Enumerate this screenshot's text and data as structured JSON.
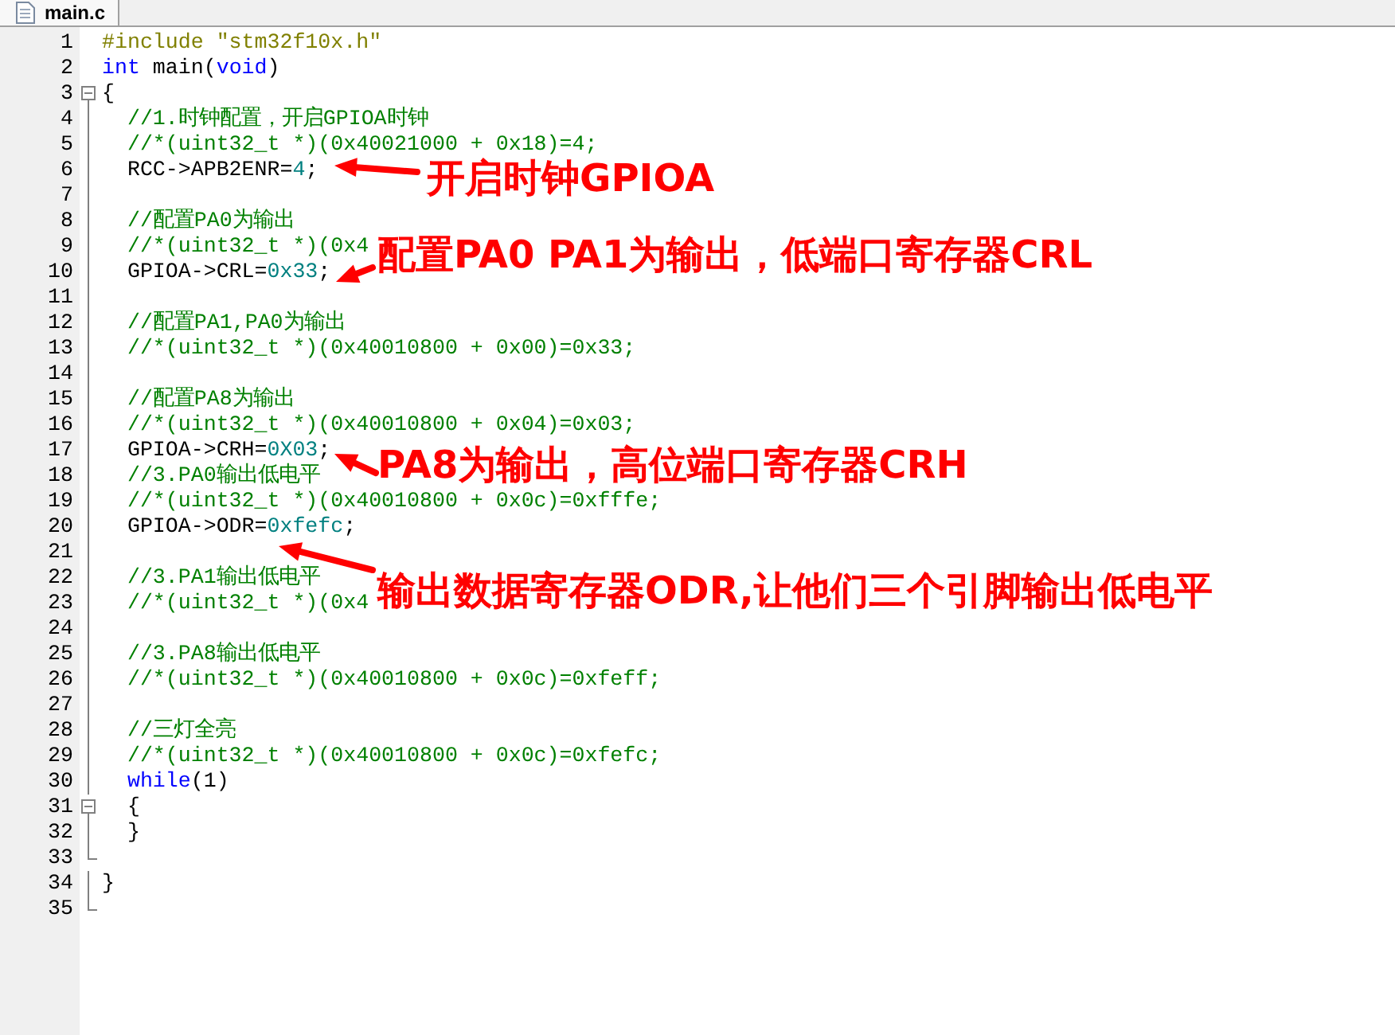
{
  "tab": {
    "label": "main.c",
    "selected": true
  },
  "lines": [
    {
      "number": "1",
      "kind": "plain",
      "segments": [
        {
          "text": "#include \"stm32f10x.h\"",
          "kind": "preprocessor"
        }
      ]
    },
    {
      "number": "2",
      "kind": "plain",
      "segments": [
        {
          "text": "int",
          "kind": "keyword"
        },
        {
          "text": " main(",
          "kind": "plain"
        },
        {
          "text": "void",
          "kind": "keyword"
        },
        {
          "text": ")",
          "kind": "plain"
        }
      ]
    },
    {
      "number": "3",
      "kind": "foldstart",
      "segments": [
        {
          "text": "{",
          "kind": "plain"
        }
      ]
    },
    {
      "number": "4",
      "kind": "folded",
      "segments": [
        {
          "text": "  //1.时钟配置，开启GPIOA时钟",
          "kind": "comment"
        }
      ]
    },
    {
      "number": "5",
      "kind": "folded",
      "segments": [
        {
          "text": "  //*(uint32_t *)(0x40021000 + 0x18)=4;",
          "kind": "comment"
        }
      ]
    },
    {
      "number": "6",
      "kind": "folded",
      "segments": [
        {
          "text": "  RCC->APB2ENR=",
          "kind": "plain"
        },
        {
          "text": "4",
          "kind": "number"
        },
        {
          "text": ";",
          "kind": "plain"
        }
      ]
    },
    {
      "number": "7",
      "kind": "folded"
    },
    {
      "number": "8",
      "kind": "folded",
      "segments": [
        {
          "text": "  //配置PA0为输出",
          "kind": "comment"
        }
      ]
    },
    {
      "number": "9",
      "kind": "folded",
      "segments": [
        {
          "text": "  //*(uint32_t *)(0x4",
          "kind": "comment"
        }
      ]
    },
    {
      "number": "10",
      "kind": "folded",
      "segments": [
        {
          "text": "  GPIOA->CRL=",
          "kind": "plain"
        },
        {
          "text": "0x33",
          "kind": "number"
        },
        {
          "text": ";",
          "kind": "plain"
        }
      ]
    },
    {
      "number": "11",
      "kind": "folded"
    },
    {
      "number": "12",
      "kind": "folded",
      "segments": [
        {
          "text": "  //配置PA1,PA0为输出",
          "kind": "comment"
        }
      ]
    },
    {
      "number": "13",
      "kind": "folded",
      "segments": [
        {
          "text": "  //*(uint32_t *)(0x40010800 + 0x00)=0x33;",
          "kind": "comment"
        }
      ]
    },
    {
      "number": "14",
      "kind": "folded"
    },
    {
      "number": "15",
      "kind": "folded",
      "segments": [
        {
          "text": "  //配置PA8为输出",
          "kind": "comment"
        }
      ]
    },
    {
      "number": "16",
      "kind": "folded",
      "segments": [
        {
          "text": "  //*(uint32_t *)(0x40010800 + 0x04)=0x03;",
          "kind": "comment"
        }
      ]
    },
    {
      "number": "17",
      "kind": "folded",
      "segments": [
        {
          "text": "  GPIOA->CRH=",
          "kind": "plain"
        },
        {
          "text": "0X03",
          "kind": "number"
        },
        {
          "text": ";",
          "kind": "plain"
        }
      ]
    },
    {
      "number": "18",
      "kind": "folded",
      "segments": [
        {
          "text": "  //3.PA0输出低电平",
          "kind": "comment"
        }
      ]
    },
    {
      "number": "19",
      "kind": "folded",
      "segments": [
        {
          "text": "  //*(uint32_t *)(0x40010800 + 0x0c)=0xfffe;",
          "kind": "comment"
        }
      ]
    },
    {
      "number": "20",
      "kind": "folded",
      "segments": [
        {
          "text": "  GPIOA->ODR=",
          "kind": "plain"
        },
        {
          "text": "0xfefc",
          "kind": "number"
        },
        {
          "text": ";",
          "kind": "plain"
        }
      ]
    },
    {
      "number": "21",
      "kind": "folded"
    },
    {
      "number": "22",
      "kind": "folded",
      "segments": [
        {
          "text": "  //3.PA1输出低电平",
          "kind": "comment"
        }
      ]
    },
    {
      "number": "23",
      "kind": "folded",
      "segments": [
        {
          "text": "  //*(uint32_t *)(0x4",
          "kind": "comment"
        }
      ]
    },
    {
      "number": "24",
      "kind": "folded"
    },
    {
      "number": "25",
      "kind": "folded",
      "segments": [
        {
          "text": "  //3.PA8输出低电平",
          "kind": "comment"
        }
      ]
    },
    {
      "number": "26",
      "kind": "folded",
      "segments": [
        {
          "text": "  //*(uint32_t *)(0x40010800 + 0x0c)=0xfeff;",
          "kind": "comment"
        }
      ]
    },
    {
      "number": "27",
      "kind": "folded"
    },
    {
      "number": "28",
      "kind": "folded",
      "segments": [
        {
          "text": "  //三灯全亮",
          "kind": "comment"
        }
      ]
    },
    {
      "number": "29",
      "kind": "folded",
      "segments": [
        {
          "text": "  //*(uint32_t *)(0x40010800 + 0x0c)=0xfefc;",
          "kind": "comment"
        }
      ]
    },
    {
      "number": "30",
      "kind": "folded",
      "segments": [
        {
          "text": "  while",
          "kind": "keyword"
        },
        {
          "text": "(1)",
          "kind": "plain"
        }
      ]
    },
    {
      "number": "31",
      "kind": "foldstart",
      "segments": [
        {
          "text": "  {",
          "kind": "plain"
        }
      ]
    },
    {
      "number": "32",
      "kind": "folded",
      "segments": [
        {
          "text": "  }",
          "kind": "plain"
        }
      ]
    },
    {
      "number": "33",
      "kind": "foldend"
    },
    {
      "number": "34",
      "kind": "folded",
      "segments": [
        {
          "text": "}",
          "kind": "plain"
        }
      ]
    },
    {
      "number": "35",
      "kind": "foldend"
    }
  ],
  "annotations": [
    {
      "text": "开启时钟GPIOA"
    },
    {
      "text": "配置PA0 PA1为输出，低端口寄存器CRL"
    },
    {
      "text": "PA8为输出，高位端口寄存器CRH"
    },
    {
      "text": "输出数据寄存器ODR,让他们三个引脚输出低电平"
    }
  ]
}
